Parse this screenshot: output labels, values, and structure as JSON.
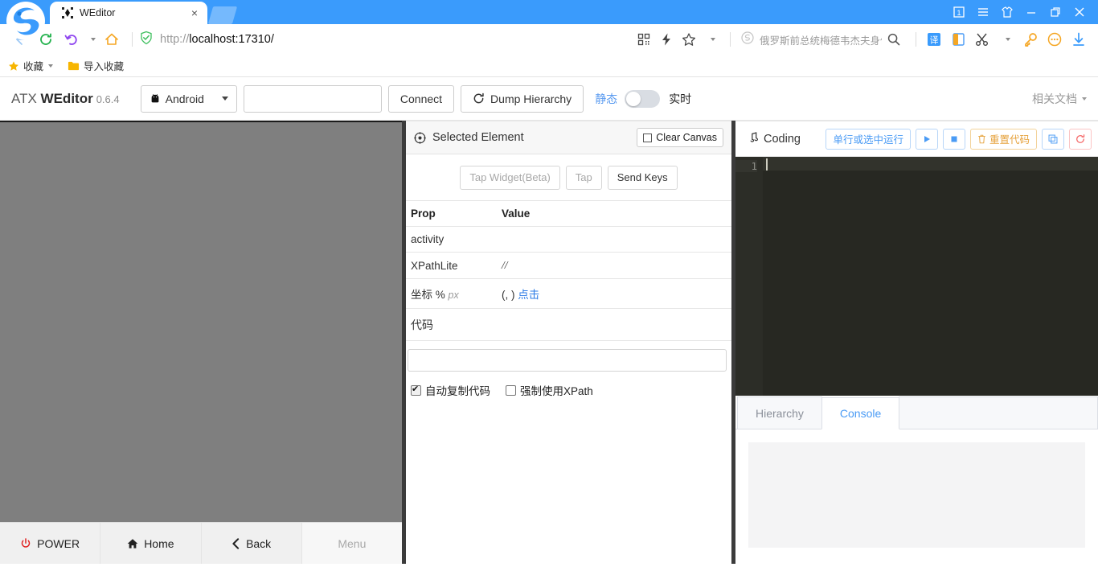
{
  "browser": {
    "tab": {
      "title": "WEditor",
      "favicon": "weditor-icon",
      "close": "×"
    },
    "window_controls": {
      "count_badge": "1",
      "menu": "hamburger-icon",
      "skin": "skin-icon",
      "minimize": "minimize-icon",
      "restore": "restore-icon",
      "close": "close-icon"
    },
    "nav": {
      "back": "back-arrow-icon",
      "forward_reload": "reload-icon",
      "history": "undo-icon",
      "home": "home-icon"
    },
    "url": {
      "scheme": "http://",
      "rest": "localhost:17310/",
      "security": "shield-icon"
    },
    "url_actions": {
      "qr": "qrcode-icon",
      "lightning": "lightning-icon",
      "bookmark": "star-icon",
      "dropdown": "chevron-down-icon"
    },
    "search": {
      "engine_icon": "sogou-logo-icon",
      "query": "俄罗斯前总统梅德韦杰夫身体",
      "submit": "search-icon"
    },
    "extensions": [
      {
        "name": "translate-icon",
        "glyph": "译"
      },
      {
        "name": "sidebar-icon",
        "glyph": ""
      },
      {
        "name": "scissors-icon",
        "glyph": ""
      },
      {
        "name": "key-icon",
        "glyph": ""
      },
      {
        "name": "more-icon",
        "glyph": ""
      },
      {
        "name": "download-icon",
        "glyph": ""
      }
    ],
    "bookmarks": [
      {
        "label": "收藏",
        "icon": "star-icon",
        "has_caret": true
      },
      {
        "label": "导入收藏",
        "icon": "folder-icon",
        "has_caret": false
      }
    ]
  },
  "app": {
    "brand": {
      "prefix": "ATX",
      "name": "WEditor",
      "version": "0.6.4"
    },
    "platform_select": {
      "value": "Android",
      "icon": "android-icon"
    },
    "serial_input": {
      "value": "",
      "placeholder": ""
    },
    "connect_button": "Connect",
    "dump_button": {
      "label": "Dump Hierarchy",
      "icon": "refresh-icon"
    },
    "mode": {
      "static_label": "静态",
      "live_label": "实时",
      "toggle_on": false
    },
    "docs_link": "相关文档"
  },
  "device": {
    "nav_buttons": [
      {
        "label": "POWER",
        "icon": "power-icon",
        "disabled": false
      },
      {
        "label": "Home",
        "icon": "home-icon",
        "disabled": false
      },
      {
        "label": "Back",
        "icon": "back-chevron-icon",
        "disabled": false
      },
      {
        "label": "Menu",
        "icon": "menu-icon",
        "disabled": true
      }
    ]
  },
  "selected_element": {
    "title": "Selected Element",
    "title_icon": "target-icon",
    "clear_canvas_button": "Clear Canvas",
    "actions": [
      {
        "label": "Tap Widget(Beta)",
        "dim": true
      },
      {
        "label": "Tap",
        "dim": true
      },
      {
        "label": "Send Keys",
        "dim": false
      }
    ],
    "table": {
      "headers": [
        "Prop",
        "Value"
      ],
      "rows": [
        {
          "prop": "activity",
          "value": ""
        },
        {
          "prop": "XPathLite",
          "value": "//"
        }
      ],
      "coord_row": {
        "prop": "坐标",
        "unit_pct": "%",
        "unit_px": "px",
        "value": "(, )",
        "link": "点击"
      }
    },
    "code_label": "代码",
    "code_input": {
      "value": "",
      "placeholder": ""
    },
    "checkboxes": [
      {
        "label": "自动复制代码",
        "checked": true
      },
      {
        "label": "强制使用XPath",
        "checked": false
      }
    ]
  },
  "coding": {
    "title": "Coding",
    "title_icon": "music-note-icon",
    "buttons": [
      {
        "name": "run-selection-button",
        "label": "单行或选中运行",
        "style": "primary"
      },
      {
        "name": "run-button",
        "label": "▶",
        "style": "primary-square"
      },
      {
        "name": "stop-button",
        "label": "■",
        "style": "primary-square"
      },
      {
        "name": "reset-code-button",
        "label": "重置代码",
        "icon": "trash-icon",
        "style": "warn"
      },
      {
        "name": "copy-code-button",
        "label": "⿴",
        "style": "primary-square"
      },
      {
        "name": "reload-button",
        "label": "↻",
        "style": "danger-square"
      }
    ],
    "editor": {
      "line_numbers": [
        "1"
      ],
      "content": ""
    },
    "tabs": [
      {
        "label": "Hierarchy",
        "active": false
      },
      {
        "label": "Console",
        "active": true
      }
    ],
    "console_output": ""
  },
  "colors": {
    "browser_blue": "#3a9bfc",
    "accent_blue": "#4a9bf5",
    "canvas_gray": "#7f7f7f",
    "editor_bg": "#272822",
    "warn": "#e6a23c",
    "danger": "#f56c6c"
  }
}
